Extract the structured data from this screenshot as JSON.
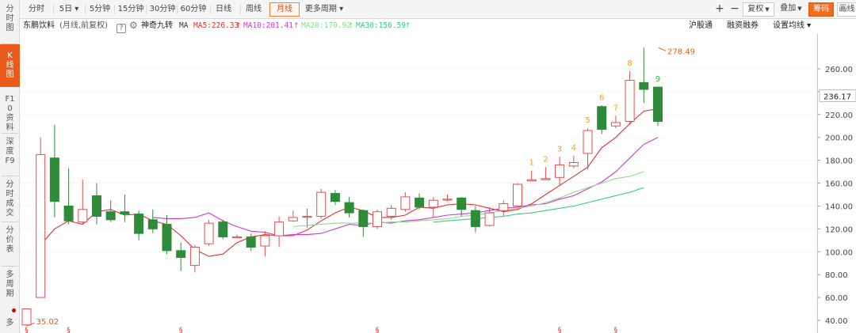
{
  "left_nav": {
    "items": [
      {
        "label": "分时图",
        "active": false,
        "name": "intraday"
      },
      {
        "label": "K线图",
        "active": true,
        "name": "kline"
      },
      {
        "label": "F10资料",
        "active": false,
        "name": "f10"
      },
      {
        "label": "深度F9",
        "active": false,
        "name": "f9"
      },
      {
        "label": "分时成交",
        "active": false,
        "name": "time-trades"
      },
      {
        "label": "分价表",
        "active": false,
        "name": "price-table"
      },
      {
        "label": "多周期",
        "active": false,
        "name": "multi-period"
      },
      {
        "label": "多",
        "active": false,
        "name": "multi"
      }
    ]
  },
  "toolbar": {
    "periods": [
      {
        "label": "分时",
        "active": false
      },
      {
        "label": "5日 ▾",
        "active": false
      },
      {
        "label": "5分钟",
        "active": false
      },
      {
        "label": "15分钟",
        "active": false
      },
      {
        "label": "30分钟",
        "active": false
      },
      {
        "label": "60分钟",
        "active": false
      },
      {
        "label": "日线",
        "active": false
      },
      {
        "label": "周线",
        "active": false
      },
      {
        "label": "月线",
        "active": true
      },
      {
        "label": "更多周期 ▾",
        "active": false
      }
    ],
    "zoom_in": "+",
    "zoom_out": "−",
    "adjust_label": "复权",
    "overlay_label": "叠加",
    "chips_label": "筹码",
    "draw_label": "画线"
  },
  "info_bar": {
    "stock_name": "东鹏饮料",
    "mode_label": "(月线,前复权)",
    "help": "?",
    "indicator": "神奇九转",
    "ma_prefix": "MA",
    "ma": [
      {
        "label": "MA5:226.33",
        "color": "#e03030"
      },
      {
        "label": "MA10:201.41",
        "color": "#d534d5"
      },
      {
        "label": "MA20:170.92",
        "color": "#8fd98f"
      },
      {
        "label": "MA30:156.59",
        "color": "#39c98a"
      }
    ],
    "hsgt": "沪股通",
    "margin": "融资融券",
    "ma_settings": "设置均线 ▾"
  },
  "chart_data": {
    "type": "candlestick",
    "ylim": [
      30,
      285
    ],
    "y_ticks": [
      40,
      60,
      80,
      100,
      120,
      140,
      160,
      180,
      200,
      220,
      240,
      260
    ],
    "y_tick_labels": [
      "40.00",
      "60.00",
      "80.00",
      "100.00",
      "120.00",
      "140.00",
      "160.00",
      "180.00",
      "200.00",
      "220.00",
      "240.00",
      "260.00"
    ],
    "current_price": 236.17,
    "current_price_label": "236.17",
    "up_color": "#e84e4e",
    "down_color": "#2e8b3a",
    "high_annotation": {
      "index": 45,
      "value": 278.49,
      "label": "278.49"
    },
    "low_annotation": {
      "index": 0,
      "value": 35.02,
      "label": "35.02"
    },
    "nine_turn_counts": [
      {
        "index": 36,
        "label": "1",
        "color": "#f0a020"
      },
      {
        "index": 37,
        "label": "2",
        "color": "#f0a020"
      },
      {
        "index": 38,
        "label": "3",
        "color": "#f0a020"
      },
      {
        "index": 39,
        "label": "4",
        "color": "#f0a020"
      },
      {
        "index": 40,
        "label": "5",
        "color": "#f0a020"
      },
      {
        "index": 41,
        "label": "6",
        "color": "#f0a020"
      },
      {
        "index": 42,
        "label": "7",
        "color": "#f0a020"
      },
      {
        "index": 43,
        "label": "8",
        "color": "#f0a020"
      },
      {
        "index": 45,
        "label": "9",
        "color": "#2eb82e"
      }
    ],
    "candles": [
      {
        "o": 36,
        "c": 50,
        "h": 50,
        "l": 35.02
      },
      {
        "o": 60,
        "c": 185,
        "h": 200,
        "l": 60
      },
      {
        "o": 182,
        "c": 144,
        "h": 211,
        "l": 130
      },
      {
        "o": 140,
        "c": 127,
        "h": 173,
        "l": 124
      },
      {
        "o": 126,
        "c": 137,
        "h": 163,
        "l": 124
      },
      {
        "o": 149,
        "c": 131,
        "h": 160,
        "l": 124
      },
      {
        "o": 135,
        "c": 128,
        "h": 145,
        "l": 126
      },
      {
        "o": 135,
        "c": 133,
        "h": 150,
        "l": 126
      },
      {
        "o": 133,
        "c": 116,
        "h": 136,
        "l": 110
      },
      {
        "o": 128,
        "c": 120,
        "h": 137,
        "l": 116
      },
      {
        "o": 124,
        "c": 101,
        "h": 132,
        "l": 98
      },
      {
        "o": 101,
        "c": 95,
        "h": 108,
        "l": 83
      },
      {
        "o": 88,
        "c": 104,
        "h": 106,
        "l": 82
      },
      {
        "o": 107,
        "c": 125,
        "h": 128,
        "l": 105
      },
      {
        "o": 126,
        "c": 113,
        "h": 128,
        "l": 111
      },
      {
        "o": 113,
        "c": 113,
        "h": 115,
        "l": 112
      },
      {
        "o": 113,
        "c": 104,
        "h": 116,
        "l": 101
      },
      {
        "o": 105,
        "c": 114,
        "h": 118,
        "l": 96
      },
      {
        "o": 114,
        "c": 126,
        "h": 131,
        "l": 104
      },
      {
        "o": 127,
        "c": 130,
        "h": 136,
        "l": 126
      },
      {
        "o": 131,
        "c": 131,
        "h": 138,
        "l": 121
      },
      {
        "o": 131,
        "c": 152,
        "h": 155,
        "l": 129
      },
      {
        "o": 151,
        "c": 144,
        "h": 154,
        "l": 141
      },
      {
        "o": 143,
        "c": 134,
        "h": 148,
        "l": 130
      },
      {
        "o": 136,
        "c": 122,
        "h": 137,
        "l": 113
      },
      {
        "o": 122,
        "c": 135,
        "h": 137,
        "l": 120
      },
      {
        "o": 131,
        "c": 138,
        "h": 141,
        "l": 128
      },
      {
        "o": 137,
        "c": 148,
        "h": 152,
        "l": 135
      },
      {
        "o": 147,
        "c": 139,
        "h": 151,
        "l": 137
      },
      {
        "o": 139,
        "c": 145,
        "h": 148,
        "l": 130
      },
      {
        "o": 146,
        "c": 146,
        "h": 150,
        "l": 144
      },
      {
        "o": 147,
        "c": 137,
        "h": 148,
        "l": 131
      },
      {
        "o": 136,
        "c": 122,
        "h": 140,
        "l": 117
      },
      {
        "o": 123,
        "c": 134,
        "h": 139,
        "l": 122
      },
      {
        "o": 136,
        "c": 142,
        "h": 145,
        "l": 131
      },
      {
        "o": 140,
        "c": 159,
        "h": 160,
        "l": 139
      },
      {
        "o": 162,
        "c": 163,
        "h": 171,
        "l": 162
      },
      {
        "o": 163,
        "c": 164,
        "h": 174,
        "l": 163
      },
      {
        "o": 165,
        "c": 176,
        "h": 183,
        "l": 158
      },
      {
        "o": 175,
        "c": 178,
        "h": 184,
        "l": 173
      },
      {
        "o": 186,
        "c": 206,
        "h": 208,
        "l": 172
      },
      {
        "o": 227,
        "c": 207,
        "h": 228,
        "l": 203
      },
      {
        "o": 210,
        "c": 213,
        "h": 219,
        "l": 208
      },
      {
        "o": 214,
        "c": 250,
        "h": 258,
        "l": 211
      },
      {
        "o": 248,
        "c": 242,
        "h": 278.49,
        "l": 230
      },
      {
        "o": 244,
        "c": 214,
        "h": 244,
        "l": 210
      }
    ],
    "ma_lines": [
      {
        "name": "MA5",
        "color": "#e03030",
        "start": 1,
        "values": [
          106,
          120,
          127,
          124,
          135,
          137,
          132,
          133,
          127,
          124,
          114,
          102,
          96,
          98,
          108,
          113,
          115,
          114,
          114,
          119,
          127,
          134,
          139,
          136,
          130,
          130,
          132,
          139,
          138,
          141,
          142,
          141,
          138,
          135,
          137,
          142,
          150,
          158,
          166,
          174,
          191,
          200,
          212,
          223,
          225
        ]
      },
      {
        "name": "MA10",
        "color": "#d534d5",
        "start": 9,
        "values": [
          130,
          129,
          129,
          130,
          134,
          127,
          122,
          118,
          117,
          114,
          115,
          115,
          116,
          120,
          124,
          123,
          126,
          125,
          127,
          128,
          130,
          132,
          133,
          134,
          136,
          138,
          139,
          141,
          142,
          146,
          149,
          155,
          161,
          170,
          182,
          194,
          200
        ]
      },
      {
        "name": "MA20",
        "color": "#8fd98f",
        "start": 19,
        "values": [
          122,
          123,
          124,
          125,
          125,
          125,
          125,
          126,
          126,
          127,
          128,
          129,
          131,
          132,
          134,
          136,
          138,
          140,
          143,
          147,
          152,
          156,
          160,
          164,
          166,
          170
        ]
      },
      {
        "name": "MA30",
        "color": "#39c98a",
        "start": 29,
        "values": [
          126,
          127,
          128,
          129,
          130,
          131,
          133,
          134,
          136,
          138,
          140,
          143,
          146,
          149,
          152,
          156
        ]
      }
    ],
    "bottom_markers_index": [
      0,
      3,
      11,
      25,
      38,
      42
    ]
  }
}
